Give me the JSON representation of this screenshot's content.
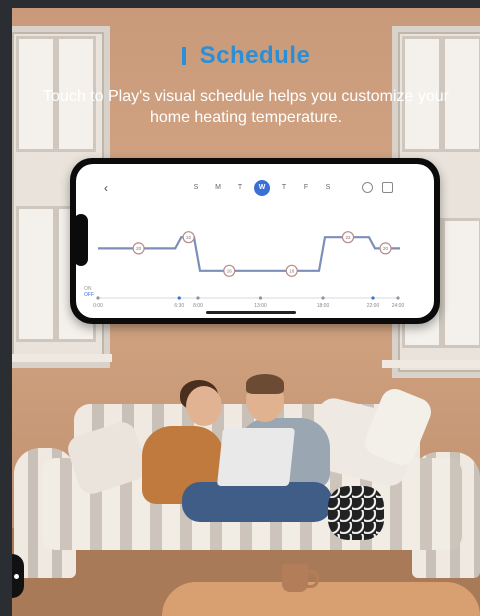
{
  "header": {
    "title": "Schedule",
    "title_icon": "vertical-bar-icon",
    "subtitle": "Touch to Play's visual schedule helps you customize your home heating temperature."
  },
  "app": {
    "back_icon": "chevron-left-icon",
    "days": [
      "S",
      "M",
      "T",
      "W",
      "T",
      "F",
      "S"
    ],
    "active_day_index": 3,
    "accent_color": "#3a6fd8",
    "legend": [
      "ON",
      "OFF"
    ],
    "times": [
      "0:00",
      "6:30",
      "8:00",
      "13:00",
      "18:00",
      "22:00",
      "24:00"
    ],
    "menu_icons": [
      "copy-icon",
      "list-icon"
    ]
  },
  "chart_data": {
    "type": "line",
    "x": [
      0,
      6.5,
      8,
      13,
      18,
      22,
      24
    ],
    "series": [
      {
        "values": [
          20,
          22,
          16,
          16,
          22,
          20,
          20
        ]
      }
    ],
    "xlabel": "",
    "ylabel": "",
    "tick_labels": [
      "0:00",
      "6:30",
      "8:00",
      "13:00",
      "18:00",
      "22:00",
      "24:00"
    ],
    "ylim": [
      14,
      24
    ],
    "grid": false
  },
  "scene": {
    "description_icon": "couple-on-sofa-photo"
  }
}
